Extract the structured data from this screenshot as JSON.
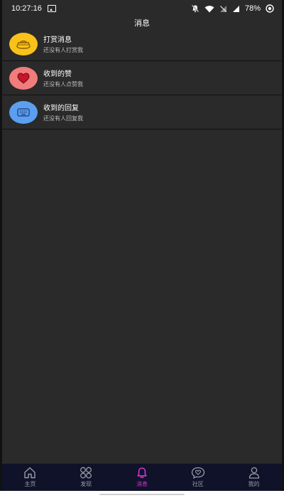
{
  "status": {
    "time": "10:27:16",
    "battery": "78%"
  },
  "header": {
    "title": "消息"
  },
  "messages": [
    {
      "title": "打赏消息",
      "subtitle": "还没有人打赏我",
      "icon": "gold-ingot-icon",
      "color": "#f8c21a"
    },
    {
      "title": "收到的赞",
      "subtitle": "还没有人点赞我",
      "icon": "heart-icon",
      "color": "#f07c7c"
    },
    {
      "title": "收到的回复",
      "subtitle": "还没有人回复我",
      "icon": "keyboard-icon",
      "color": "#5c9ff0"
    }
  ],
  "nav": [
    {
      "label": "主页",
      "icon": "home-icon"
    },
    {
      "label": "发现",
      "icon": "discover-grid-icon"
    },
    {
      "label": "消息",
      "icon": "bell-icon",
      "active": true
    },
    {
      "label": "社区",
      "icon": "chat-bubble-icon"
    },
    {
      "label": "我的",
      "icon": "user-icon"
    }
  ],
  "colors": {
    "background": "#2a2a2a",
    "nav_background": "#0f1228",
    "active_tab": "#d335d8"
  }
}
